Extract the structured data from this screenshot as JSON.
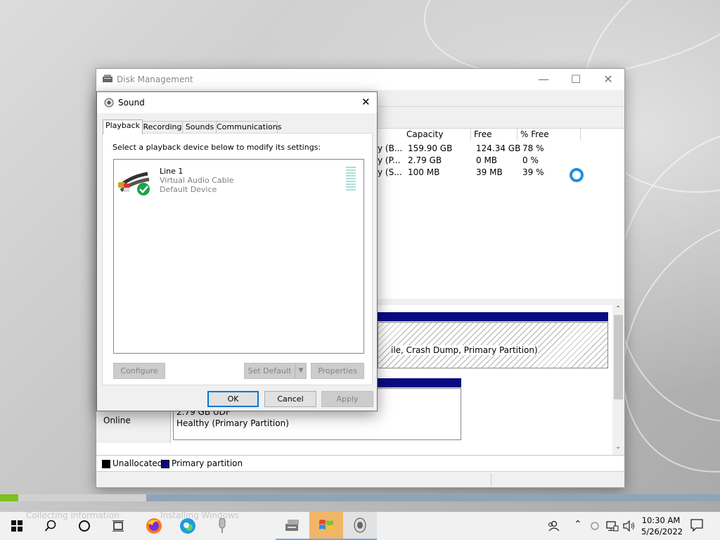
{
  "desktop": {
    "overlay_texts": [
      "Collecting information",
      "Installing Windows"
    ]
  },
  "disk_mgmt": {
    "title": "Disk Management",
    "columns": [
      "Capacity",
      "Free Spa...",
      "% Free"
    ],
    "rows": [
      {
        "frag": "y (B...",
        "capacity": "159.90 GB",
        "free": "124.34 GB",
        "pct": "78 %"
      },
      {
        "frag": "y (P...",
        "capacity": "2.79 GB",
        "free": "0 MB",
        "pct": "0 %"
      },
      {
        "frag": "y (S...",
        "capacity": "100 MB",
        "free": "39 MB",
        "pct": "39 %"
      }
    ],
    "partition_text": "ile, Crash Dump, Primary Partition)",
    "disk1_size": "2.79 GB",
    "disk1_status": "Online",
    "part2_size": "2.79 GB UDF",
    "part2_status": "Healthy (Primary Partition)",
    "legend": {
      "unallocated": "Unallocated",
      "primary": "Primary partition"
    },
    "colors": {
      "unallocated": "#000000",
      "primary": "#0a0a82"
    }
  },
  "sound": {
    "title": "Sound",
    "tabs": [
      "Playback",
      "Recording",
      "Sounds",
      "Communications"
    ],
    "instruction": "Select a playback device below to modify its settings:",
    "device": {
      "name": "Line 1",
      "desc": "Virtual Audio Cable",
      "status": "Default Device"
    },
    "buttons": {
      "configure": "Configure",
      "set_default": "Set Default",
      "properties": "Properties",
      "ok": "OK",
      "cancel": "Cancel",
      "apply": "Apply"
    }
  },
  "taskbar": {
    "time": "10:30 AM",
    "date": "5/26/2022"
  }
}
